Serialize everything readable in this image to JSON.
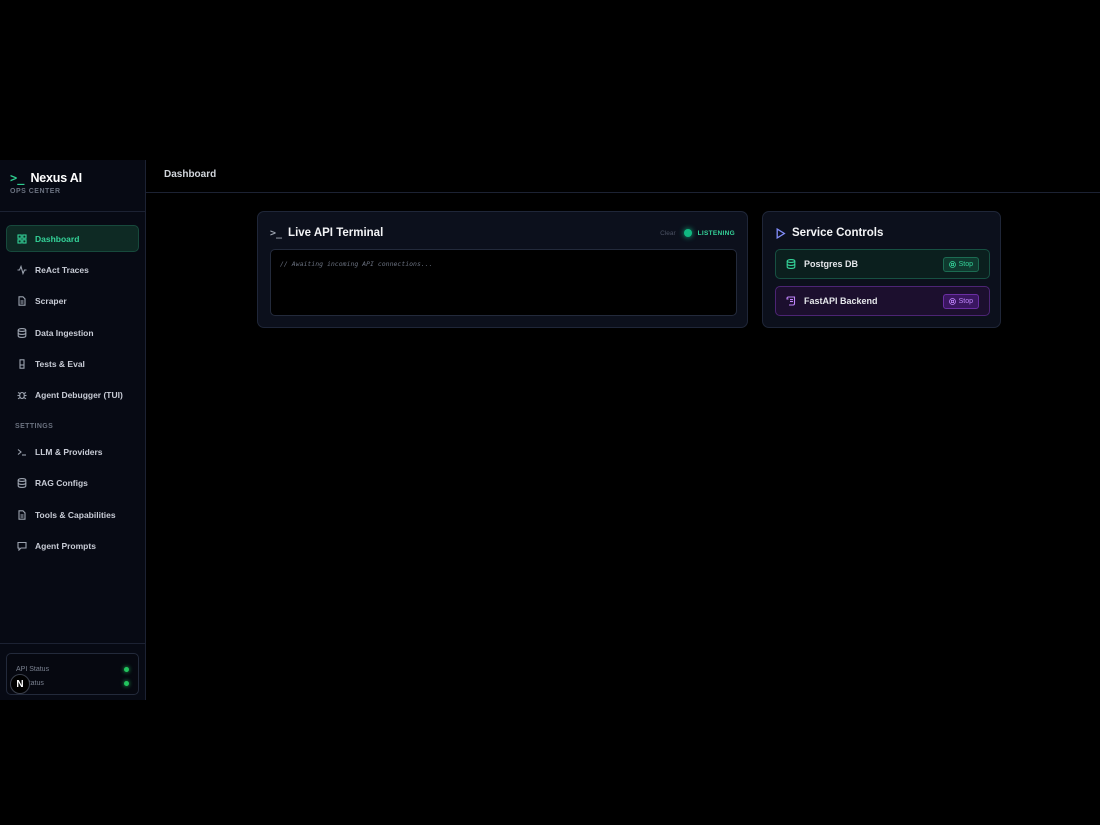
{
  "brand": {
    "title": "Nexus AI",
    "subtitle": "OPS CENTER"
  },
  "nav": {
    "items": [
      {
        "label": "Dashboard",
        "icon": "grid-icon",
        "active": true
      },
      {
        "label": "ReAct Traces",
        "icon": "activity-icon"
      },
      {
        "label": "Scraper",
        "icon": "file-icon"
      },
      {
        "label": "Data Ingestion",
        "icon": "database-icon"
      },
      {
        "label": "Tests & Eval",
        "icon": "beaker-icon"
      },
      {
        "label": "Agent Debugger (TUI)",
        "icon": "bug-icon"
      }
    ],
    "settings_label": "SETTINGS",
    "settings_items": [
      {
        "label": "LLM & Providers",
        "icon": "terminal-icon"
      },
      {
        "label": "RAG Configs",
        "icon": "database-icon"
      },
      {
        "label": "Tools & Capabilities",
        "icon": "file-icon"
      },
      {
        "label": "Agent Prompts",
        "icon": "message-icon"
      }
    ]
  },
  "status": {
    "api_label": "API Status",
    "second_label": "Status",
    "badge": "N",
    "color_ok": "#22c55e"
  },
  "header": {
    "title": "Dashboard"
  },
  "terminal": {
    "title": "Live API Terminal",
    "clear_label": "Clear",
    "state_label": "LISTENING",
    "placeholder_text": "// Awaiting incoming API connections..."
  },
  "services": {
    "title": "Service Controls",
    "items": [
      {
        "name": "Postgres DB",
        "action": "Stop",
        "accent": "#34d399"
      },
      {
        "name": "FastAPI Backend",
        "action": "Stop",
        "accent": "#c084fc"
      }
    ]
  }
}
